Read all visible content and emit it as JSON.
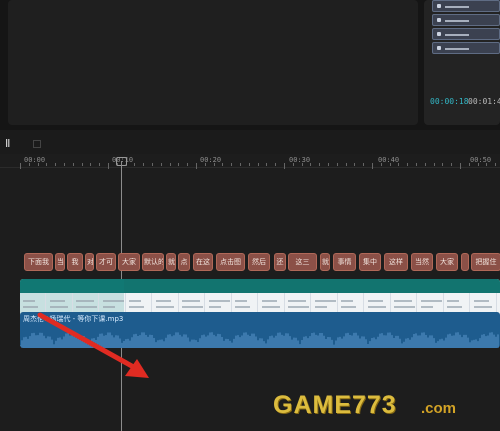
{
  "preview": {
    "current_time": "00:00:18",
    "total_time": "00:01:4"
  },
  "timeline": {
    "ruler_labels": [
      "00:00",
      "00:10",
      "00:20",
      "00:30",
      "00:40",
      "00:50"
    ],
    "subtitle_clips": [
      "下面我",
      "当",
      "我",
      "对",
      "才可",
      "大家",
      "默认的",
      "就",
      "点",
      "在这",
      "点击图",
      "然后",
      "还",
      "这三",
      "就",
      "事情",
      "集中",
      "这样",
      "当然",
      "大家",
      "",
      "把握住",
      ""
    ],
    "audio_title": "周杰伦&杨瑞代 - 等你下课.mp3"
  },
  "watermark": {
    "main": "GAME773",
    "suffix": ".com"
  },
  "colors": {
    "accent": "#33b7c6",
    "subtitle_clip": "#8b5047",
    "video_header": "#12746f",
    "audio": "#1e5c8e",
    "arrow": "#e02b22"
  }
}
